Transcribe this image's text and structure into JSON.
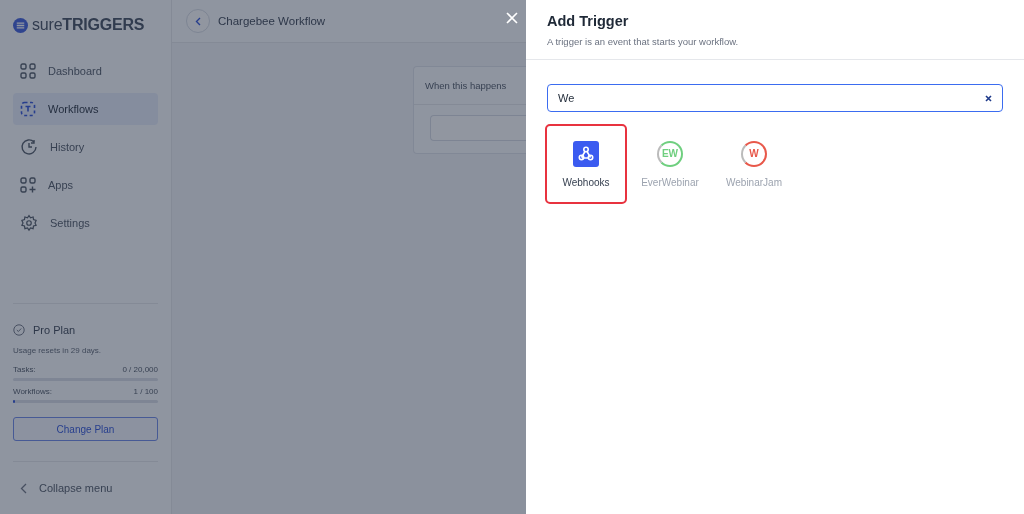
{
  "brand": {
    "part_1": "sure",
    "part_2": "TRIGGERS"
  },
  "sidebar": {
    "items": [
      {
        "label": "Dashboard",
        "kind": "dashboard",
        "selected": false
      },
      {
        "label": "Workflows",
        "kind": "workflows",
        "selected": true
      },
      {
        "label": "History",
        "kind": "history",
        "selected": false
      },
      {
        "label": "Apps",
        "kind": "apps",
        "selected": false
      },
      {
        "label": "Settings",
        "kind": "settings",
        "selected": false
      }
    ],
    "plan": {
      "name": "Pro Plan",
      "note": "Usage resets in 29 days.",
      "meters": [
        {
          "label": "Tasks:",
          "reading": "0 / 20,000",
          "level": 0
        },
        {
          "label": "Workflows:",
          "reading": "1 / 100",
          "level": 0.01
        }
      ],
      "button": "Change Plan"
    },
    "collapse": "Collapse menu"
  },
  "header": {
    "title": "Chargebee Workflow"
  },
  "canvas": {
    "card_title": "When this happens"
  },
  "drawer": {
    "title": "Add Trigger",
    "subtitle": "A trigger is an event that starts your workflow.",
    "search": {
      "value": "We"
    },
    "apps": [
      {
        "name": "Webhooks",
        "kind": "webhook",
        "selected": true
      },
      {
        "name": "EverWebinar",
        "kind": "ring",
        "logo_text": "EW",
        "color": "#6fcf7f",
        "selected": false
      },
      {
        "name": "WebinarJam",
        "kind": "ring",
        "logo_text": "W",
        "color": "#e8584a",
        "selected": false
      }
    ]
  }
}
